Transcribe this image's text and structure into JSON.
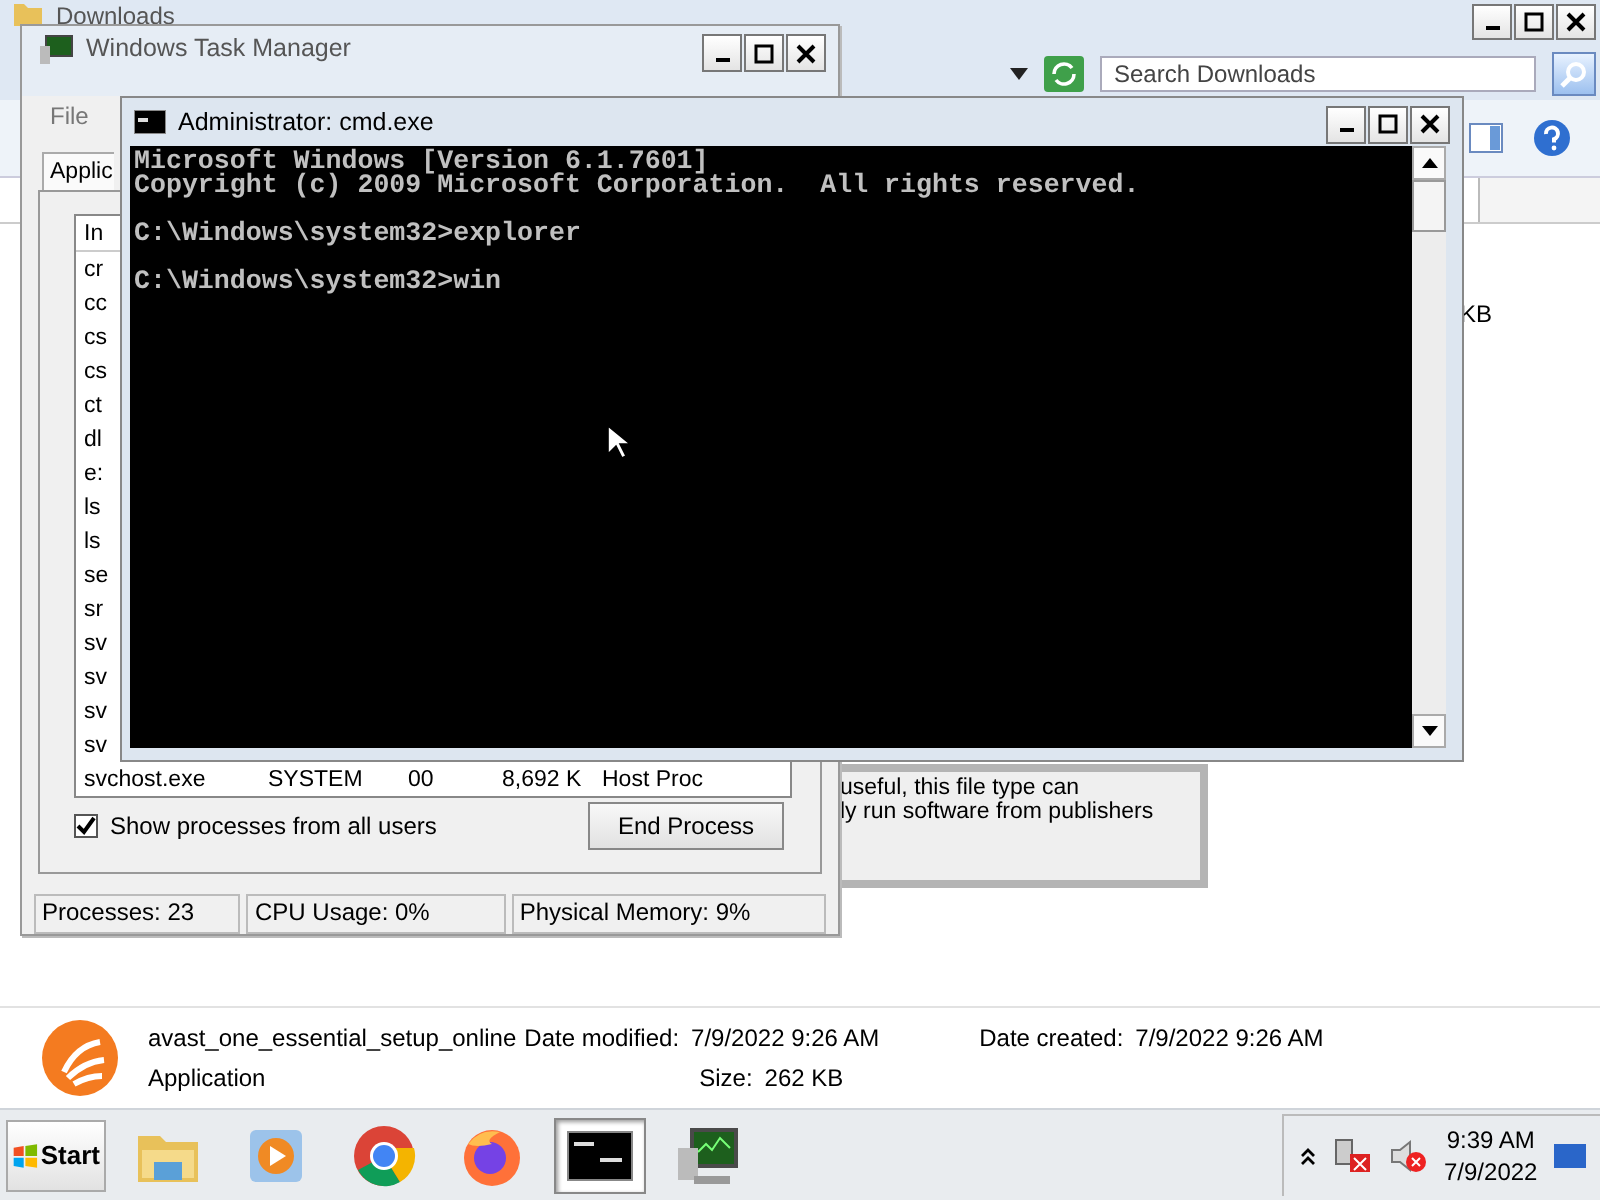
{
  "explorer": {
    "title": "Downloads",
    "search": {
      "placeholder": "Search Downloads"
    },
    "column_fragment": "KB",
    "info_lines": [
      "useful, this file type can",
      "ly run software from publishers"
    ],
    "details": {
      "name": "avast_one_essential_setup_online",
      "type": "Application",
      "modified": {
        "label": "Date modified:",
        "value": "7/9/2022 9:26 AM"
      },
      "size": {
        "label": "Size:",
        "value": "262 KB"
      },
      "created": {
        "label": "Date created:",
        "value": "7/9/2022 9:26 AM"
      }
    }
  },
  "task_manager": {
    "title": "Windows Task Manager",
    "menu": [
      "File"
    ],
    "tabs": [
      {
        "label": "Applic",
        "selected": false
      }
    ],
    "list": {
      "header": "In",
      "rows": [
        "cr",
        "cc",
        "cs",
        "cs",
        "ct",
        "dl",
        "e:",
        "ls",
        "ls",
        "se",
        "sr",
        "sv",
        "sv",
        "sv",
        "sv"
      ],
      "last_row": [
        "svchost.exe",
        "SYSTEM",
        "00",
        "8,692 K",
        "Host Proc"
      ]
    },
    "show_all_users": {
      "label": "Show processes from all users",
      "checked": true
    },
    "end_button": "End Process",
    "status": [
      "Processes: 23",
      "CPU Usage: 0%",
      "Physical Memory: 9%"
    ]
  },
  "cmd": {
    "title": "Administrator: cmd.exe",
    "blocks": [
      [
        "Microsoft Windows [Version 6.1.7601]",
        "Copyright (c) 2009 Microsoft Corporation.  All rights reserved."
      ],
      [
        "C:\\Windows\\system32>explorer"
      ],
      [
        "C:\\Windows\\system32>win"
      ]
    ]
  },
  "taskbar": {
    "start": "Start",
    "items": [
      {
        "kind": "folder",
        "selected": false
      },
      {
        "kind": "player",
        "selected": false
      },
      {
        "kind": "ring",
        "selected": false
      },
      {
        "kind": "fox",
        "selected": false
      },
      {
        "kind": "console",
        "selected": true
      },
      {
        "kind": "monitor",
        "selected": false
      }
    ],
    "clock": {
      "time": "9:39 AM",
      "date": "7/9/2022"
    }
  }
}
